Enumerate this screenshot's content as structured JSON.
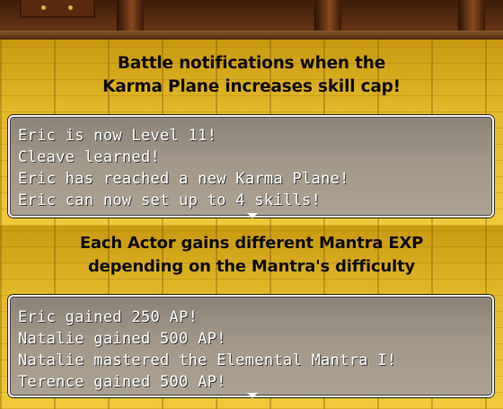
{
  "panels": [
    {
      "caption_lines": [
        "Battle notifications when the",
        "Karma Plane increases skill cap!"
      ],
      "messages": [
        "Eric is now Level 11!",
        "Cleave learned!",
        "Eric has reached a new Karma Plane!",
        "Eric can now set up to 4 skills!"
      ]
    },
    {
      "caption_lines": [
        "Each Actor gains different  Mantra EXP",
        "depending on the Mantra's difficulty"
      ],
      "messages": [
        "Eric gained 250 AP!",
        "Natalie gained 500 AP!",
        "Natalie mastered the Elemental Mantra I!",
        "Terence gained 500 AP!"
      ]
    }
  ],
  "icons": {
    "continue": "down-triangle-icon"
  },
  "colors": {
    "floor": "#e4bb2a",
    "wall": "#5a2c12",
    "message_box": "#a39888",
    "caption_text": "#0a0a0a",
    "message_text": "#ffffff"
  }
}
